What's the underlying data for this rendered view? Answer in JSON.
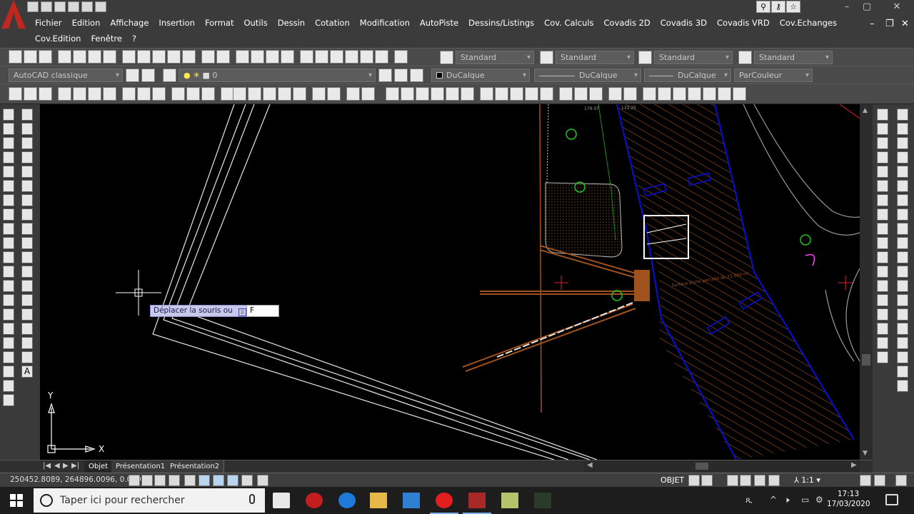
{
  "menus": {
    "row1": [
      "Fichier",
      "Edition",
      "Affichage",
      "Insertion",
      "Format",
      "Outils",
      "Dessin",
      "Cotation",
      "Modification",
      "AutoPiste",
      "Dessins/Listings",
      "Cov. Calculs",
      "Covadis 2D",
      "Covadis 3D",
      "Covadis VRD",
      "Cov.Echanges"
    ],
    "row2": [
      "Cov.Edition",
      "Fenêtre",
      "?"
    ]
  },
  "window_controls": {
    "minimize": "–",
    "maximize": "▢",
    "close": "✕"
  },
  "sub_controls": {
    "minimize": "–",
    "restore": "❐",
    "close": "✕"
  },
  "styles": {
    "text": "Standard",
    "dim": "Standard",
    "table": "Standard",
    "multileader": "Standard"
  },
  "workspace": "AutoCAD classique",
  "layer": "0",
  "properties": {
    "color": "DuCalque",
    "linetype": "DuCalque",
    "lineweight": "DuCalque",
    "plotstyle": "ParCouleur"
  },
  "canvas": {
    "tooltip": "Déplacer la souris ou",
    "tooltip_icon": "⇩",
    "input_value": "F",
    "ucs_x": "X",
    "ucs_y": "Y",
    "label_top_1": "179.07",
    "label_top_2": "133.25",
    "hatch_label": "Surface d'une parcelle de 22 000 m²"
  },
  "tabs": {
    "nav": [
      "|◀",
      "◀",
      "▶",
      "▶|"
    ],
    "items": [
      "Objet",
      "Présentation1",
      "Présentation2"
    ],
    "active": 0
  },
  "status": {
    "coords": "250452.8089, 264896.0096, 0.0000",
    "mode": "OBJET",
    "scale": "⅄ 1:1 ▾"
  },
  "taskbar": {
    "search_placeholder": "Taper ici pour rechercher",
    "time": "17:13",
    "date": "17/03/2020"
  },
  "tray": {
    "user": "ጺ",
    "chevron": "^",
    "volume": "🕨",
    "battery": "▭",
    "network": "⚙"
  },
  "colors": {
    "hatch": "#a0521e",
    "boundary": "#0d0dd8",
    "lines": "#e6e6e6",
    "tree": "#22c322",
    "magenta": "#ff40ff",
    "red": "#e02424"
  }
}
